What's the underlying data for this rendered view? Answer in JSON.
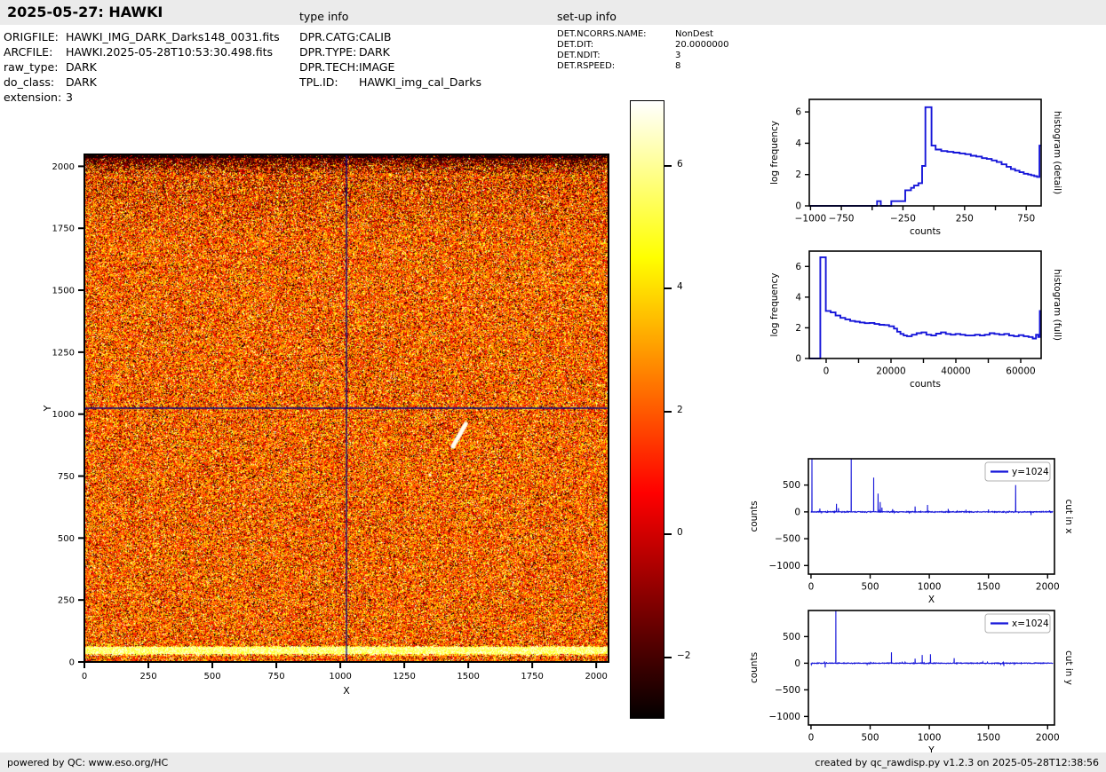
{
  "header": {
    "title": "2025-05-27: HAWKI",
    "sections": {
      "type_info": "type info",
      "setup_info": "set-up info"
    }
  },
  "file_info": {
    "rows": [
      {
        "label": "ORIGFILE:",
        "value": "HAWKI_IMG_DARK_Darks148_0031.fits"
      },
      {
        "label": "ARCFILE:",
        "value": "HAWKI.2025-05-28T10:53:30.498.fits"
      },
      {
        "label": "raw_type:",
        "value": "DARK"
      },
      {
        "label": "do_class:",
        "value": "DARK"
      },
      {
        "label": "extension:",
        "value": "3"
      }
    ]
  },
  "type_info": {
    "rows": [
      {
        "label": "DPR.CATG:",
        "value": "CALIB"
      },
      {
        "label": "DPR.TYPE:",
        "value": "DARK"
      },
      {
        "label": "DPR.TECH:",
        "value": "IMAGE"
      },
      {
        "label": "TPL.ID:",
        "value": "HAWKI_img_cal_Darks"
      }
    ]
  },
  "setup_info": {
    "rows": [
      {
        "label": "DET.NCORRS.NAME:",
        "value": "NonDest"
      },
      {
        "label": "DET.DIT:",
        "value": "20.0000000"
      },
      {
        "label": "DET.NDIT:",
        "value": "3"
      },
      {
        "label": "DET.RSPEED:",
        "value": "8"
      }
    ]
  },
  "footer": {
    "left": "powered by QC: www.eso.org/HC",
    "right": "created by qc_rawdisp.py v1.2.3 on 2025-05-28T12:38:56"
  },
  "colors": {
    "line_blue": "#1616d9",
    "crosshair_navy": "#000082",
    "panel_gray": "#ebebeb",
    "legend_border": "#b0b0b0"
  },
  "chart_data": [
    {
      "id": "raw_image",
      "type": "heatmap",
      "xlabel": "X",
      "ylabel": "Y",
      "xlim": [
        0,
        2048
      ],
      "ylim": [
        0,
        2048
      ],
      "xticks": [
        0,
        250,
        500,
        750,
        1000,
        1250,
        1500,
        1750,
        2000
      ],
      "yticks": [
        0,
        250,
        500,
        750,
        1000,
        1250,
        1500,
        1750,
        2000
      ],
      "colormap": "hot",
      "crosshair_x": 1024,
      "crosshair_y": 1024,
      "features": {
        "description": "noisy raw dark frame speckle, hot colormap",
        "dark_band_top_rows": [
          1985,
          2048
        ],
        "bright_band_bottom_rows": [
          30,
          58
        ],
        "white_streak_data_xy": [
          [
            1440,
            870
          ],
          [
            1490,
            960
          ]
        ]
      }
    },
    {
      "id": "colorbar",
      "type": "colorbar",
      "colormap": "hot",
      "range": [
        -3.0,
        7.07
      ],
      "ticks": [
        -2,
        0,
        2,
        4,
        6
      ],
      "tick_labels": [
        "−2",
        "0",
        "2",
        "4",
        "6"
      ]
    },
    {
      "id": "histogram_detail",
      "type": "step-line",
      "xlabel": "counts",
      "ylabel": "log frequency",
      "side_label": "histogram (detail)",
      "xlim": [
        -1010,
        871
      ],
      "ylim": [
        0,
        6.8
      ],
      "xticks": [
        -1000,
        -750,
        -500,
        -250,
        0,
        250,
        500,
        750
      ],
      "xtick_labels": [
        "−1000",
        "−750",
        "",
        "−250",
        "",
        "250",
        "",
        "750"
      ],
      "yticks": [
        0,
        2,
        4,
        6
      ],
      "steps": [
        [
          -1010,
          0
        ],
        [
          -460,
          0.3
        ],
        [
          -430,
          0
        ],
        [
          -345,
          0.3
        ],
        [
          -232,
          1.0
        ],
        [
          -185,
          1.15
        ],
        [
          -160,
          1.3
        ],
        [
          -125,
          1.45
        ],
        [
          -95,
          2.55
        ],
        [
          -68,
          6.3
        ],
        [
          -18,
          3.85
        ],
        [
          15,
          3.6
        ],
        [
          60,
          3.5
        ],
        [
          110,
          3.45
        ],
        [
          160,
          3.4
        ],
        [
          210,
          3.35
        ],
        [
          255,
          3.3
        ],
        [
          300,
          3.2
        ],
        [
          345,
          3.15
        ],
        [
          390,
          3.05
        ],
        [
          430,
          3.0
        ],
        [
          470,
          2.9
        ],
        [
          510,
          2.8
        ],
        [
          550,
          2.65
        ],
        [
          590,
          2.5
        ],
        [
          625,
          2.35
        ],
        [
          660,
          2.25
        ],
        [
          695,
          2.15
        ],
        [
          730,
          2.05
        ],
        [
          765,
          2.0
        ],
        [
          790,
          1.95
        ],
        [
          815,
          1.9
        ],
        [
          838,
          1.85
        ],
        [
          857,
          3.85
        ]
      ]
    },
    {
      "id": "histogram_full",
      "type": "step-line",
      "xlabel": "counts",
      "ylabel": "log frequency",
      "side_label": "histogram (full)",
      "xlim": [
        -5200,
        66300
      ],
      "ylim": [
        0,
        7.0
      ],
      "xticks": [
        0,
        10000,
        20000,
        30000,
        40000,
        50000,
        60000
      ],
      "xtick_labels": [
        "0",
        "",
        "20000",
        "",
        "40000",
        "",
        "60000"
      ],
      "yticks": [
        0,
        2,
        4,
        6
      ],
      "steps": [
        [
          -5200,
          0
        ],
        [
          -1800,
          6.6
        ],
        [
          -100,
          3.1
        ],
        [
          1400,
          3.0
        ],
        [
          2900,
          2.8
        ],
        [
          4400,
          2.65
        ],
        [
          5900,
          2.55
        ],
        [
          7400,
          2.45
        ],
        [
          8900,
          2.4
        ],
        [
          10400,
          2.35
        ],
        [
          11900,
          2.3
        ],
        [
          13400,
          2.32
        ],
        [
          14900,
          2.25
        ],
        [
          16400,
          2.2
        ],
        [
          17900,
          2.18
        ],
        [
          19400,
          2.1
        ],
        [
          20900,
          1.95
        ],
        [
          21900,
          1.75
        ],
        [
          22900,
          1.6
        ],
        [
          23900,
          1.5
        ],
        [
          24900,
          1.45
        ],
        [
          26400,
          1.55
        ],
        [
          27900,
          1.65
        ],
        [
          29400,
          1.7
        ],
        [
          30900,
          1.55
        ],
        [
          32400,
          1.5
        ],
        [
          33900,
          1.62
        ],
        [
          35400,
          1.7
        ],
        [
          36900,
          1.6
        ],
        [
          38400,
          1.55
        ],
        [
          39900,
          1.6
        ],
        [
          41400,
          1.55
        ],
        [
          42900,
          1.5
        ],
        [
          44400,
          1.5
        ],
        [
          45900,
          1.55
        ],
        [
          47400,
          1.5
        ],
        [
          48900,
          1.55
        ],
        [
          50400,
          1.65
        ],
        [
          51900,
          1.6
        ],
        [
          53400,
          1.55
        ],
        [
          54900,
          1.6
        ],
        [
          56400,
          1.5
        ],
        [
          57900,
          1.45
        ],
        [
          59400,
          1.52
        ],
        [
          60900,
          1.45
        ],
        [
          62400,
          1.4
        ],
        [
          63700,
          1.3
        ],
        [
          64700,
          1.55
        ],
        [
          65400,
          1.4
        ],
        [
          65900,
          3.1
        ]
      ]
    },
    {
      "id": "cut_in_x",
      "type": "line",
      "xlabel": "X",
      "ylabel": "counts",
      "side_label": "cut in x",
      "legend": "y=1024",
      "xlim": [
        -22,
        2058
      ],
      "ylim": [
        -1160,
        990
      ],
      "xticks": [
        0,
        500,
        1000,
        1500,
        2000
      ],
      "yticks": [
        -1000,
        -500,
        0,
        500
      ],
      "ytick_labels": [
        "−1000",
        "−500",
        "0",
        "500"
      ],
      "baseline": 0,
      "noise_amplitude": 12,
      "spikes": [
        [
          8,
          990
        ],
        [
          75,
          60
        ],
        [
          215,
          150
        ],
        [
          232,
          70
        ],
        [
          340,
          990
        ],
        [
          530,
          640
        ],
        [
          567,
          340
        ],
        [
          585,
          185
        ],
        [
          600,
          80
        ],
        [
          690,
          50
        ],
        [
          880,
          100
        ],
        [
          985,
          130
        ],
        [
          1160,
          55
        ],
        [
          1310,
          40
        ],
        [
          1500,
          45
        ],
        [
          1730,
          500
        ],
        [
          1860,
          -60
        ]
      ]
    },
    {
      "id": "cut_in_y",
      "type": "line",
      "xlabel": "Y",
      "ylabel": "counts",
      "side_label": "cut in y",
      "legend": "x=1024",
      "xlim": [
        -22,
        2058
      ],
      "ylim": [
        -1160,
        990
      ],
      "xticks": [
        0,
        500,
        1000,
        1500,
        2000
      ],
      "yticks": [
        -1000,
        -500,
        0,
        500
      ],
      "ytick_labels": [
        "−1000",
        "−500",
        "0",
        "500"
      ],
      "baseline": 0,
      "noise_amplitude": 10,
      "spikes": [
        [
          120,
          -80
        ],
        [
          210,
          990
        ],
        [
          680,
          205
        ],
        [
          880,
          85
        ],
        [
          940,
          155
        ],
        [
          1010,
          170
        ],
        [
          1210,
          95
        ],
        [
          1630,
          -55
        ]
      ]
    }
  ]
}
